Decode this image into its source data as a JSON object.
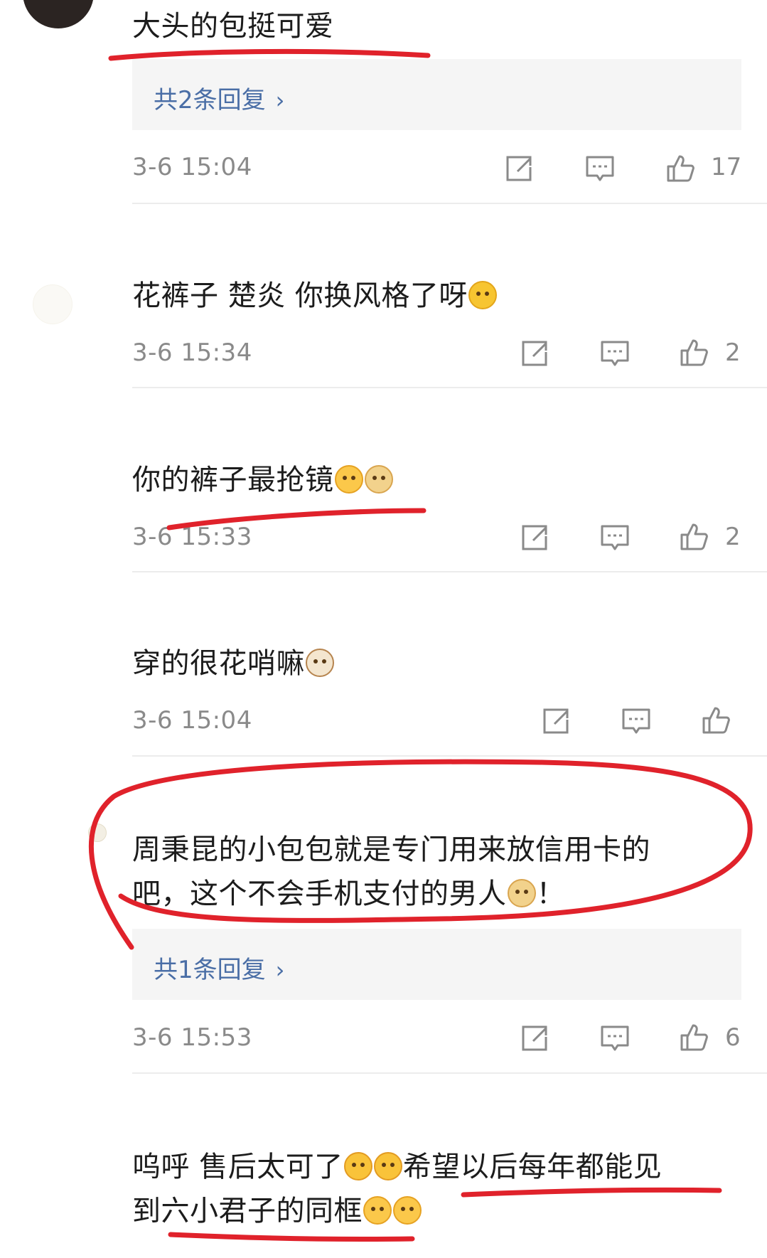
{
  "comments": [
    {
      "text_lines": [
        "大头的包挺可爱"
      ],
      "reply_label": "共2条回复",
      "time": "3-6 15:04",
      "likes": "17"
    },
    {
      "text_lines": [
        "花裤子 楚炎 你换风格了呀"
      ],
      "time": "3-6 15:34",
      "likes": "2"
    },
    {
      "text_lines": [
        "你的裤子最抢镜"
      ],
      "time": "3-6 15:33",
      "likes": "2"
    },
    {
      "text_lines": [
        "穿的很花哨嘛"
      ],
      "time": "3-6 15:04",
      "likes": ""
    },
    {
      "text_lines": [
        "周秉昆的小包包就是专门用来放信用卡的",
        "吧，这个不会手机支付的男人",
        "！"
      ],
      "reply_label": "共1条回复",
      "time": "3-6 15:53",
      "likes": "6"
    },
    {
      "text_lines": [
        "呜呼  售后太可了",
        "希望以后每年都能见",
        "到六小君子的同框"
      ]
    }
  ],
  "icons": {
    "share": "share-icon",
    "reply": "comment-icon",
    "like": "thumbs-up-icon",
    "chevron": "chevron-right-icon"
  },
  "colors": {
    "annotation_red": "#e0222b",
    "reply_link": "#4a6ea6",
    "meta_gray": "#8a8a8a"
  }
}
